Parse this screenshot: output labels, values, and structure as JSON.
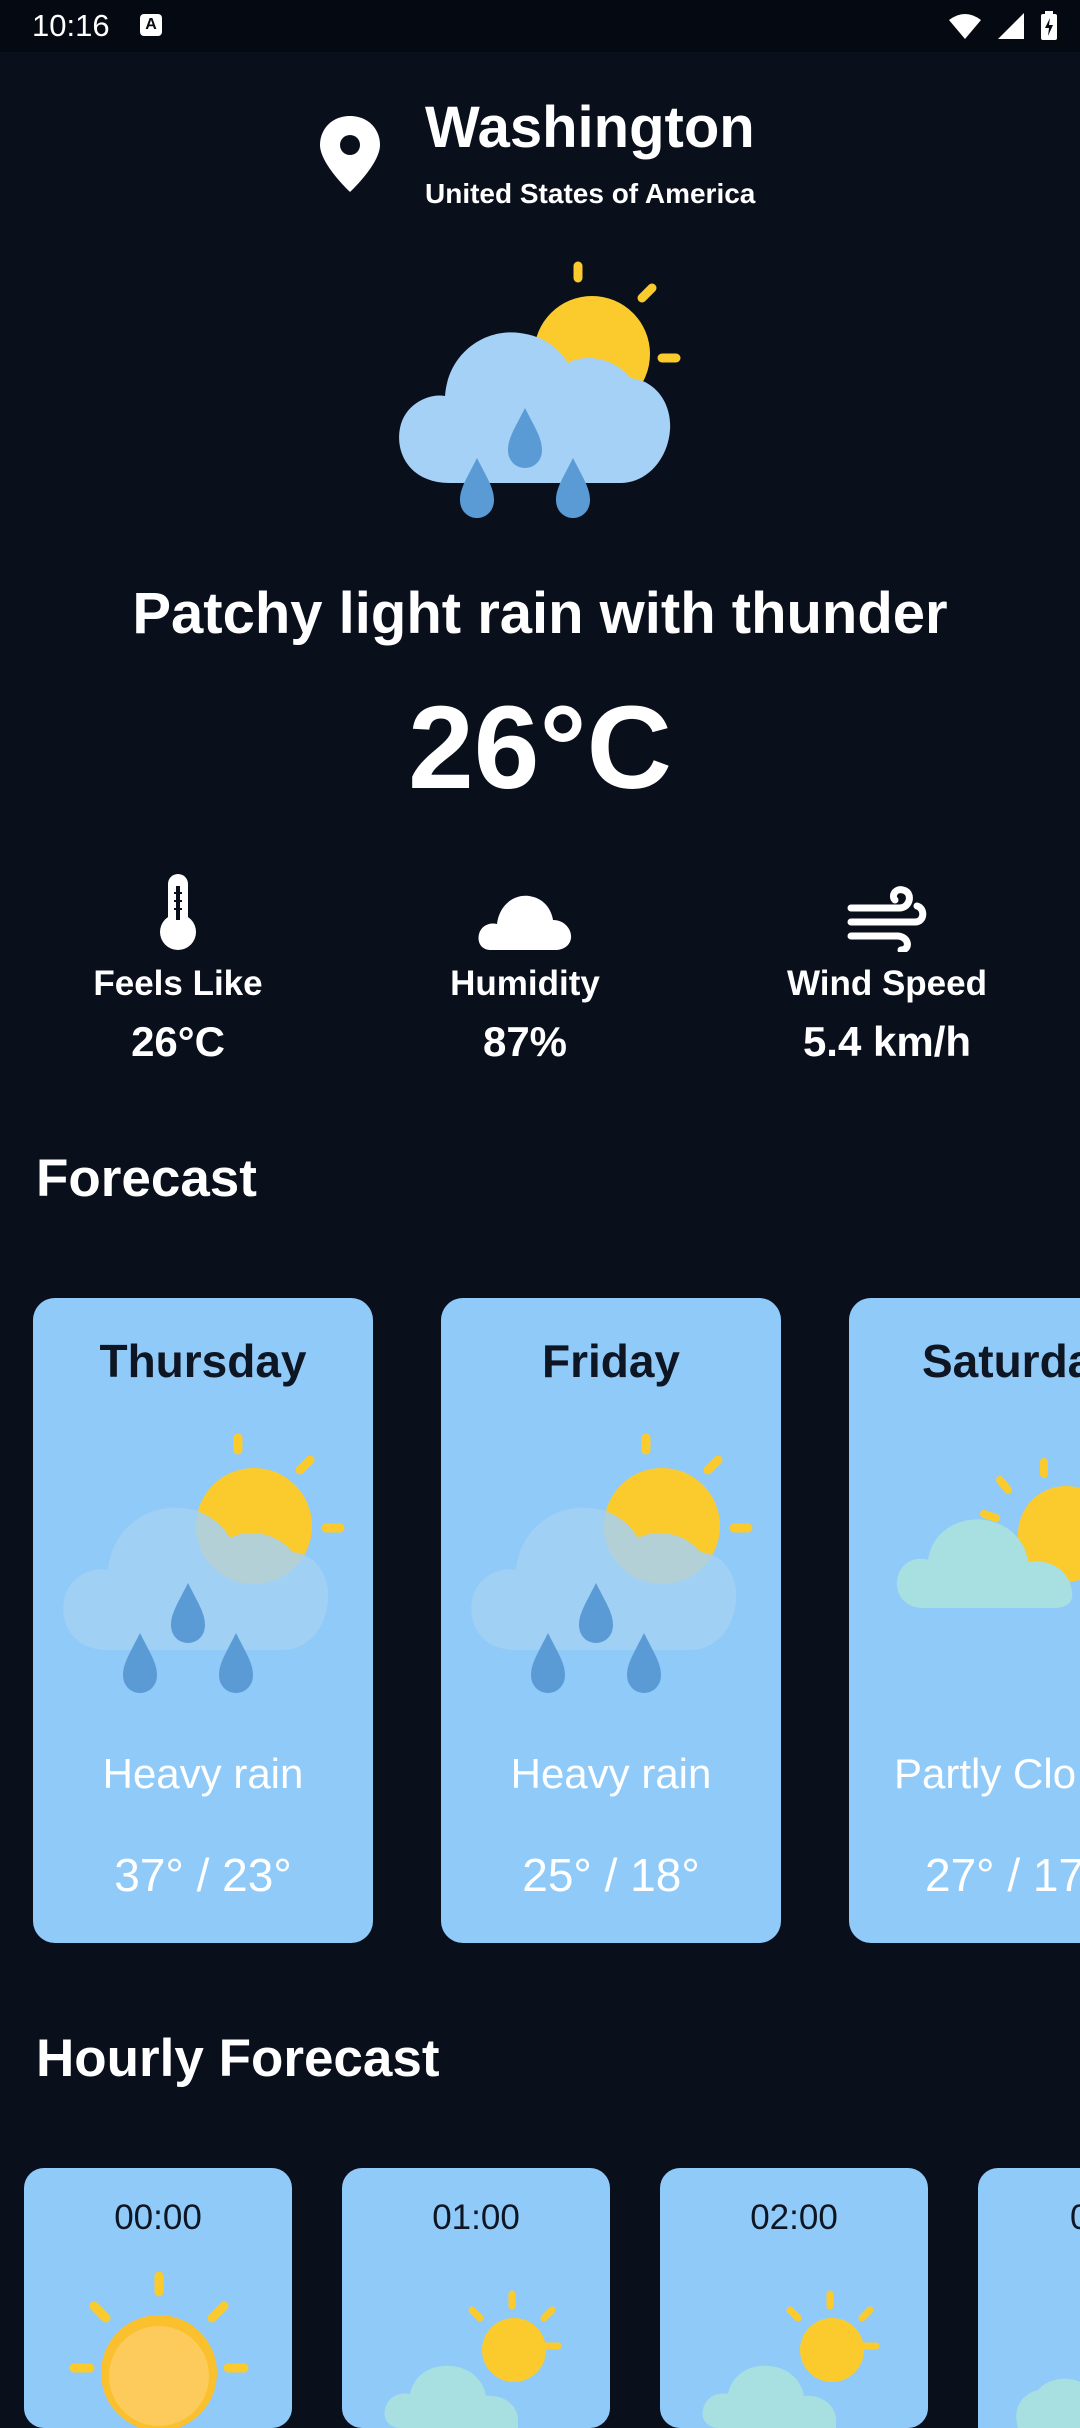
{
  "status_bar": {
    "time": "10:16",
    "notification_icon": "A"
  },
  "location": {
    "city": "Washington",
    "country": "United States of America"
  },
  "current": {
    "icon": "rain-thunder-sun-cloud-icon",
    "condition": "Patchy light rain with thunder",
    "temperature": "26°C"
  },
  "metrics": [
    {
      "icon": "thermometer-icon",
      "label": "Feels Like",
      "value": "26°C"
    },
    {
      "icon": "cloud-icon",
      "label": "Humidity",
      "value": "87%"
    },
    {
      "icon": "wind-icon",
      "label": "Wind Speed",
      "value": "5.4 km/h"
    }
  ],
  "forecast": {
    "title": "Forecast",
    "days": [
      {
        "day": "Thursday",
        "condition": "Heavy rain",
        "range": "37° / 23°",
        "icon": "heavy-rain-icon"
      },
      {
        "day": "Friday",
        "condition": "Heavy rain",
        "range": "25° / 18°",
        "icon": "heavy-rain-icon"
      },
      {
        "day": "Saturda",
        "condition": "Partly Clo",
        "range": "27° / 17",
        "icon": "partly-cloudy-icon"
      }
    ]
  },
  "hourly": {
    "title": "Hourly Forecast",
    "hours": [
      {
        "time": "00:00",
        "icon": "sunny-icon"
      },
      {
        "time": "01:00",
        "icon": "partly-cloudy-icon"
      },
      {
        "time": "02:00",
        "icon": "partly-cloudy-icon"
      },
      {
        "time": "0",
        "icon": "partly-cloudy-icon"
      }
    ]
  },
  "colors": {
    "background": "#0a0f1c",
    "card": "#90caf9",
    "sun": "#fbcb2d",
    "cloud": "#a4d1f5",
    "raindrop": "#5b9bd5"
  }
}
